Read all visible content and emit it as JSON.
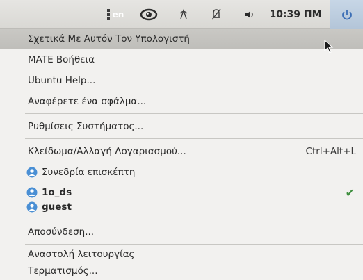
{
  "panel": {
    "keyboard_indicator": "en",
    "clock": "10:39 ΠΜ",
    "icons": [
      "keyboard-layout-icon",
      "eye-icon",
      "wifi-icon",
      "notification-off-icon",
      "volume-icon",
      "power-icon"
    ]
  },
  "menu": {
    "about": "Σχετικά Με Αυτόν Τον Υπολογιστή",
    "mate_help": "MATE Βοήθεια",
    "ubuntu_help": "Ubuntu Help...",
    "report_bug": "Αναφέρετε ένα σφάλμα...",
    "system_settings": "Ρυθμίσεις Συστήματος...",
    "lock": "Κλείδωμα/Αλλαγή Λογαριασμού...",
    "lock_shortcut": "Ctrl+Alt+L",
    "guest_session": "Συνεδρία επισκέπτη",
    "users": [
      {
        "name": "1o_ds",
        "active": true
      },
      {
        "name": "guest",
        "active": false
      }
    ],
    "logout": "Αποσύνδεση...",
    "suspend": "Αναστολή λειτουργίας",
    "shutdown": "Τερματισμός..."
  },
  "colors": {
    "accent_user_icon": "#4a8fd4",
    "check": "#3f8f3f",
    "panel": "#dedddA"
  }
}
